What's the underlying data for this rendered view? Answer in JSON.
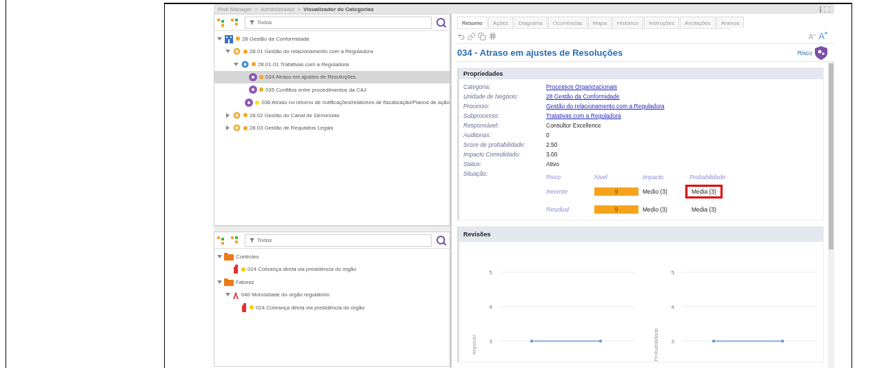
{
  "breadcrumb": [
    {
      "kind": "link",
      "text": "Risk Manager"
    },
    {
      "kind": "separator",
      "text": ">"
    },
    {
      "kind": "link",
      "text": "Administrador"
    },
    {
      "kind": "separator",
      "text": ">"
    },
    {
      "kind": "current",
      "text": "Visualizador de Categorias"
    }
  ],
  "top_tree": {
    "filter": {
      "value": "Todos"
    },
    "items": [
      {
        "kind": "business-unit",
        "color": "#f5a623",
        "label": "28 Gestão da Conformidade",
        "expanded": true,
        "selected": false,
        "children": [
          {
            "kind": "process",
            "color": "#f5a623",
            "label": "28.01 Gestão do relacionamento com a Reguladora",
            "expanded": true,
            "selected": false,
            "children": [
              {
                "kind": "subprocess",
                "color": "#f5a623",
                "label": "28.01.01 Tratativas com a Reguladora",
                "expanded": true,
                "selected": false,
                "children": [
                  {
                    "kind": "risk",
                    "color": "#f5a623",
                    "label": "034 Atraso em ajustes de Resoluções",
                    "selected": true
                  },
                  {
                    "kind": "risk",
                    "color": "#f5a623",
                    "label": "035 Conflitos entre procedimentos da CAJ",
                    "selected": false
                  },
                  {
                    "kind": "risk",
                    "color": "#f2e600",
                    "label": "036 Atraso no retorno de notificações/relatórios de fiscalização/Planos de ação",
                    "selected": false
                  }
                ]
              }
            ]
          },
          {
            "kind": "process",
            "color": "#f5a623",
            "label": "28.02 Gestão do Canal de Denúncias",
            "expanded": false,
            "selected": false
          },
          {
            "kind": "process",
            "color": "#f5a623",
            "label": "28.03 Gestão de Requisitos Legais",
            "expanded": false,
            "selected": false
          }
        ]
      }
    ]
  },
  "bottom_tree": {
    "filter": {
      "value": "Todos"
    },
    "items": [
      {
        "kind": "folder",
        "label": "Controles",
        "expanded": true,
        "selected": false,
        "children": [
          {
            "kind": "control",
            "color": "#f2d000",
            "label": "024 Cobrança direta via presidência do órgão",
            "selected": false
          }
        ]
      },
      {
        "kind": "folder",
        "label": "Fatores",
        "expanded": true,
        "selected": false,
        "children": [
          {
            "kind": "factor",
            "label": "040 Morosidade do órgão regulatório",
            "expanded": true,
            "selected": false,
            "children": [
              {
                "kind": "control",
                "color": "#f2d000",
                "label": "024 Cobrança direta via presidência do órgão",
                "selected": false
              }
            ]
          }
        ]
      }
    ]
  },
  "tabs": [
    {
      "label": "Resumo",
      "selected": true
    },
    {
      "label": "Ações",
      "selected": false
    },
    {
      "label": "Diagrama",
      "selected": false
    },
    {
      "label": "Ocorrências",
      "selected": false
    },
    {
      "label": "Mapa",
      "selected": false
    },
    {
      "label": "Histórico",
      "selected": false
    },
    {
      "label": "Instruções",
      "selected": false
    },
    {
      "label": "Anotações",
      "selected": false
    },
    {
      "label": "Anexos",
      "selected": false
    }
  ],
  "font_buttons": [
    {
      "kind": "decrease",
      "text": "A"
    },
    {
      "kind": "increase",
      "text": "A"
    }
  ],
  "title": "034 - Atraso em ajustes de Resoluções",
  "type_label": "Risco",
  "properties": {
    "heading": "Propriedades",
    "rows": [
      {
        "label": "Categoria:",
        "value": "Processos Organizacionais",
        "kind": "link"
      },
      {
        "label": "Unidade de Negócio:",
        "value": "28 Gestão da Conformidade",
        "kind": "link"
      },
      {
        "label": "Processo:",
        "value": "Gestão do relacionamento com a Reguladora",
        "kind": "link"
      },
      {
        "label": "Subprocesso:",
        "value": "Tratativas com a Reguladora",
        "kind": "link"
      },
      {
        "label": "Responsável:",
        "value": "Consultor Excellence",
        "kind": "text"
      },
      {
        "label": "Auditorias:",
        "value": "0",
        "kind": "text"
      },
      {
        "label": "Score de probabilidade:",
        "value": "2.50",
        "kind": "text"
      },
      {
        "label": "Impacto Consolidado:",
        "value": "3.00",
        "kind": "text"
      },
      {
        "label": "Status:",
        "value": "Ativo",
        "kind": "text"
      }
    ],
    "situation": {
      "label": "Situação:",
      "columns": [
        "Risco",
        "Nivel",
        "Impacto",
        "Probabilidade"
      ],
      "rows": [
        {
          "name": "Inerente",
          "nivel": "9",
          "impacto": "Medio (3)",
          "probabilidade": "Media (3)",
          "highlighted": true
        },
        {
          "name": "Residual",
          "nivel": "9",
          "impacto": "Medio (3)",
          "probabilidade": "Media (3)",
          "highlighted": false
        }
      ]
    }
  },
  "revisions": {
    "heading": "Revisões",
    "charts": [
      {
        "chart_data": {
          "type": "line",
          "ylabel": "Impacto",
          "series": [
            {
              "color": "#6f9fd8",
              "values": [
                3,
                3
              ]
            }
          ],
          "ylim": [
            3,
            5
          ],
          "yticks": [
            3,
            4,
            5
          ]
        }
      },
      {
        "chart_data": {
          "type": "line",
          "ylabel": "Probabilidade",
          "series": [
            {
              "color": "#6f9fd8",
              "values": [
                3,
                3
              ]
            }
          ],
          "ylim": [
            3,
            5
          ],
          "yticks": [
            3,
            4,
            5
          ]
        }
      }
    ]
  }
}
